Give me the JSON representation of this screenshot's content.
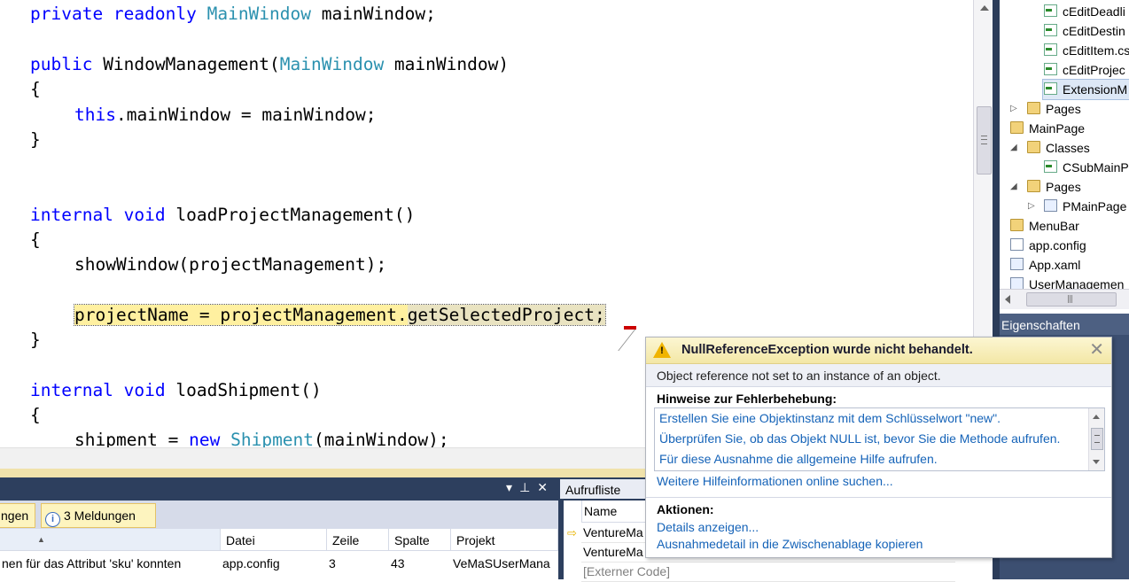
{
  "editor": {
    "lines": {
      "l1": {
        "kw": "private readonly ",
        "type": "MainWindow",
        "rest": " mainWindow;"
      },
      "l2": {
        "kw": "public ",
        "name": "WindowManagement(",
        "type": "MainWindow",
        "rest": " mainWindow)"
      },
      "l3": "{",
      "l4": {
        "kw": "this",
        "rest": ".mainWindow = mainWindow;"
      },
      "l5": "}",
      "l6": {
        "kw": "internal void ",
        "rest": "loadProjectManagement()"
      },
      "l7": "{",
      "l8": "showWindow(projectManagement);",
      "l9": {
        "part1": "projectName = projectManagement.",
        "part2": "getSelectedProject;"
      },
      "l10": "}",
      "l11": {
        "kw": "internal void ",
        "rest": "loadShipment()"
      },
      "l12": "{",
      "l13": {
        "pre": "shipment = ",
        "kw": "new ",
        "type": "Shipment",
        "rest": "(mainWindow);"
      }
    }
  },
  "solution_explorer": {
    "items": [
      {
        "label": "cEditDeadli",
        "icon": "csharp-file-icon"
      },
      {
        "label": "cEditDestin",
        "icon": "csharp-file-icon"
      },
      {
        "label": "cEditItem.cs",
        "icon": "csharp-file-icon"
      },
      {
        "label": "cEditProjec",
        "icon": "csharp-file-icon"
      },
      {
        "label": "ExtensionM",
        "icon": "csharp-file-icon",
        "selected": true
      },
      {
        "label": "Pages",
        "icon": "folder-icon"
      },
      {
        "label": "MainPage",
        "icon": "folder-icon"
      },
      {
        "label": "Classes",
        "icon": "folder-icon"
      },
      {
        "label": "CSubMainP",
        "icon": "csharp-file-icon"
      },
      {
        "label": "Pages",
        "icon": "folder-icon"
      },
      {
        "label": "PMainPage",
        "icon": "xaml-file-icon"
      },
      {
        "label": "MenuBar",
        "icon": "folder-icon"
      },
      {
        "label": "app.config",
        "icon": "config-file-icon"
      },
      {
        "label": "App.xaml",
        "icon": "xaml-file-icon"
      },
      {
        "label": "UserManagemen",
        "icon": "xaml-file-icon"
      }
    ],
    "properties_title": "Eigenschaften"
  },
  "error_list": {
    "toolbar": {
      "warnings_label": "ngen",
      "messages_label": "3 Meldungen"
    },
    "columns": {
      "file": "Datei",
      "line": "Zeile",
      "column": "Spalte",
      "project": "Projekt"
    },
    "rows": [
      {
        "description": "nen für das Attribut 'sku' konnten",
        "file": "app.config",
        "line": "3",
        "column": "43",
        "project": "VeMaSUserMana"
      }
    ]
  },
  "call_stack": {
    "title": "Aufrufliste",
    "column_name": "Name",
    "rows": [
      {
        "name": "VentureMa",
        "current": true
      },
      {
        "name": "VentureMa",
        "current": false
      },
      {
        "name": "[Externer Code]",
        "current": false
      }
    ]
  },
  "exception_popup": {
    "title": "NullReferenceException wurde nicht behandelt.",
    "message": "Object reference not set to an instance of an object.",
    "hints_label": "Hinweise zur Fehlerbehebung:",
    "hints": [
      "Erstellen Sie eine Objektinstanz mit dem Schlüsselwort \"new\".",
      "Überprüfen Sie, ob das Objekt NULL ist, bevor Sie die Methode aufrufen.",
      "Für diese Ausnahme die allgemeine Hilfe aufrufen."
    ],
    "more_help": "Weitere Hilfeinformationen online suchen...",
    "actions_label": "Aktionen:",
    "action_details": "Details anzeigen...",
    "action_copy": "Ausnahmedetail in die Zwischenablage kopieren",
    "close_glyph": "✕"
  },
  "colors": {
    "keyword": "#0000ff",
    "type": "#2b91af",
    "link": "#1563b8",
    "highlight": "#fff0a0",
    "panel_dark": "#2d3f5e"
  }
}
